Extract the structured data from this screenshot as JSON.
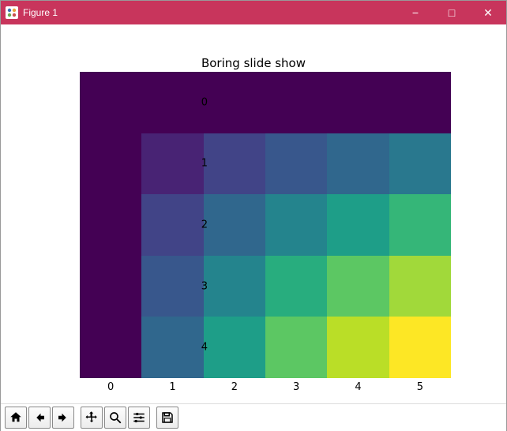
{
  "window": {
    "title": "Figure 1",
    "controls": {
      "minimize": "−",
      "maximize": "□",
      "close": "✕"
    }
  },
  "toolbar": {
    "home": "Home",
    "back": "Back",
    "forward": "Forward",
    "pan": "Pan",
    "zoom": "Zoom",
    "configure": "Configure subplots",
    "save": "Save"
  },
  "chart_data": {
    "type": "heatmap",
    "title": "Boring slide show",
    "xlabel": "",
    "ylabel": "",
    "x_ticks": [
      0,
      1,
      2,
      3,
      4,
      5
    ],
    "y_ticks": [
      0,
      1,
      2,
      3,
      4
    ],
    "xlim": [
      -0.5,
      5.5
    ],
    "ylim": [
      -0.5,
      4.5
    ],
    "colormap": "viridis",
    "vmin": 0,
    "vmax": 20,
    "values": [
      [
        0,
        0,
        0,
        0,
        0,
        0
      ],
      [
        0,
        1,
        2,
        3,
        4,
        5
      ],
      [
        0,
        2,
        4,
        6,
        8,
        10
      ],
      [
        0,
        3,
        6,
        9,
        12,
        15
      ],
      [
        0,
        4,
        8,
        12,
        16,
        20
      ]
    ],
    "cell_colors": [
      [
        "#440154",
        "#440154",
        "#440154",
        "#440154",
        "#440154",
        "#440154"
      ],
      [
        "#440154",
        "#482374",
        "#414487",
        "#38578c",
        "#30678d",
        "#29788e"
      ],
      [
        "#440154",
        "#414487",
        "#30678d",
        "#24848d",
        "#1e9e88",
        "#35b678"
      ],
      [
        "#440154",
        "#38578c",
        "#24848d",
        "#28ad7e",
        "#5cc763",
        "#a1d93a"
      ],
      [
        "#440154",
        "#30678d",
        "#1e9e88",
        "#5cc763",
        "#bade27",
        "#fde725"
      ]
    ]
  }
}
